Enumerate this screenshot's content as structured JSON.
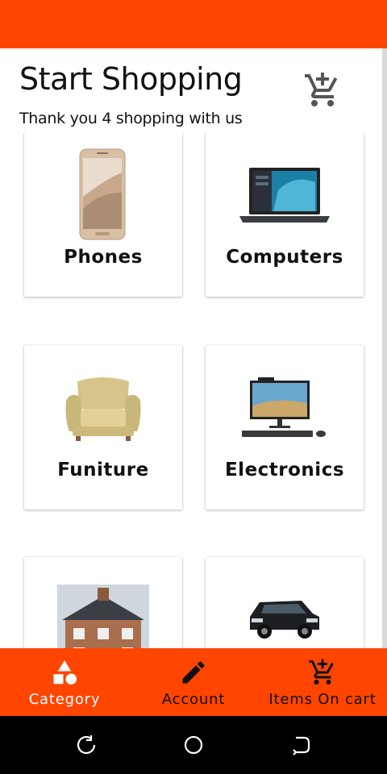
{
  "header": {
    "title": "Start Shopping",
    "subtitle": "Thank you 4 shopping with us",
    "cart_icon": "add-shopping-cart-icon"
  },
  "categories": [
    {
      "label": "Phones",
      "image": "smartphone-image"
    },
    {
      "label": "Computers",
      "image": "laptop-image"
    },
    {
      "label": "Funiture",
      "image": "armchair-image"
    },
    {
      "label": "Electronics",
      "image": "desktop-computer-image"
    },
    {
      "label": "",
      "image": "house-image"
    },
    {
      "label": "",
      "image": "car-image"
    }
  ],
  "bottom_nav": {
    "items": [
      {
        "label": "Category",
        "icon": "shapes-icon",
        "active": true
      },
      {
        "label": "Account",
        "icon": "pencil-icon",
        "active": false
      },
      {
        "label": "Items On cart",
        "icon": "add-shopping-cart-icon",
        "active": false
      }
    ]
  },
  "colors": {
    "accent": "#ff4500",
    "active_label": "#ffffff",
    "text": "#111111",
    "system_nav": "#000000"
  }
}
